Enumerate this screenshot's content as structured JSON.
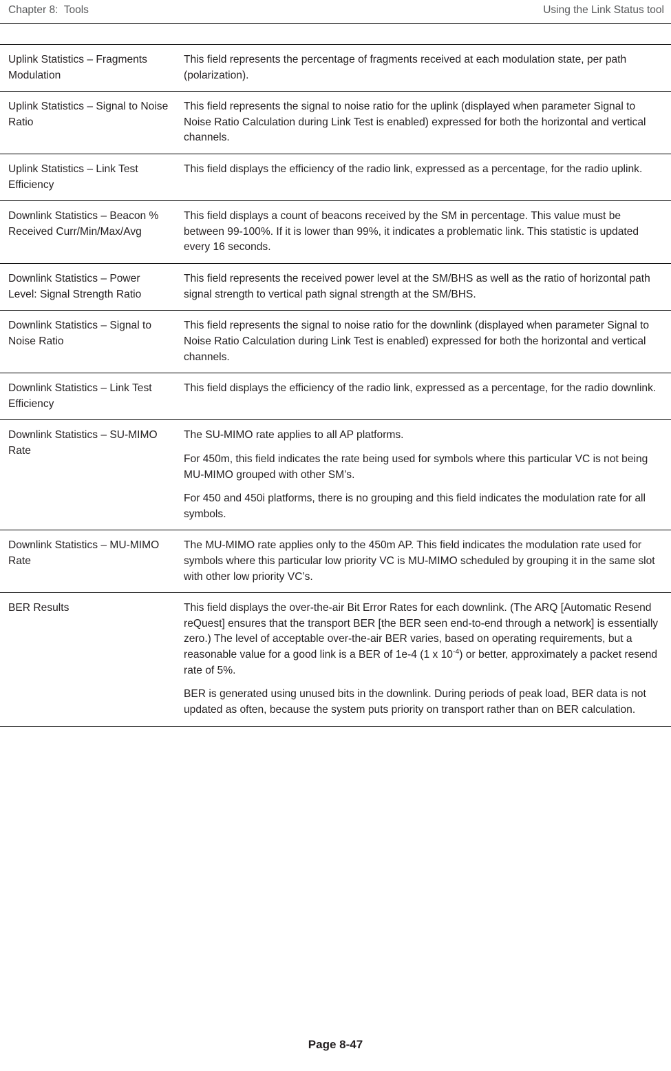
{
  "header": {
    "left": "Chapter 8:  Tools",
    "right": "Using the Link Status tool"
  },
  "rows": [
    {
      "term": "Uplink Statistics – Fragments Modulation",
      "paragraphs": [
        "This field represents the percentage of fragments received at each modulation state, per path (polarization)."
      ]
    },
    {
      "term": "Uplink Statistics – Signal to Noise Ratio",
      "paragraphs": [
        "This field represents the signal to noise ratio for the uplink (displayed when parameter Signal to Noise Ratio Calculation during Link Test is enabled) expressed for both the horizontal and vertical channels."
      ]
    },
    {
      "term": "Uplink Statistics – Link Test Efficiency",
      "paragraphs": [
        "This field displays the efficiency of the radio link, expressed as a percentage, for the radio uplink."
      ]
    },
    {
      "term": "Downlink Statistics – Beacon % Received Curr/Min/Max/Avg",
      "paragraphs": [
        "This field displays a count of beacons received by the SM in percentage. This value must be between 99-100%. If it is lower than 99%, it indicates a problematic link. This statistic is updated every 16 seconds."
      ]
    },
    {
      "term": "Downlink Statistics – Power Level: Signal Strength Ratio",
      "paragraphs": [
        "This field represents the received power level at the SM/BHS as well as the ratio of horizontal path signal strength to vertical path signal strength at the SM/BHS."
      ]
    },
    {
      "term": "Downlink Statistics – Signal to Noise Ratio",
      "paragraphs": [
        "This field represents the signal to noise ratio for the downlink (displayed when parameter Signal to Noise Ratio Calculation during Link Test is enabled) expressed for both the horizontal and vertical channels."
      ]
    },
    {
      "term": "Downlink Statistics – Link Test Efficiency",
      "paragraphs": [
        "This field displays the efficiency of the radio link, expressed as a percentage, for the radio downlink."
      ]
    },
    {
      "term": "Downlink Statistics – SU-MIMO Rate",
      "paragraphs": [
        "The SU-MIMO rate applies to all AP platforms.",
        "For 450m, this field indicates the rate being used for symbols where this particular VC is not being MU-MIMO grouped with other SM’s.",
        "For 450 and 450i platforms, there is no grouping and this field indicates the modulation rate for all symbols."
      ]
    },
    {
      "term": "Downlink Statistics – MU-MIMO Rate",
      "paragraphs": [
        "The MU-MIMO rate applies only to the 450m AP. This field indicates the modulation rate used for symbols where this particular low priority VC is MU-MIMO scheduled by grouping it in the same slot with other low priority VC’s."
      ]
    },
    {
      "term": "BER Results",
      "paragraphs": [
        "BER_SPECIAL",
        "BER is generated using unused bits in the downlink. During periods of peak load, BER data is not updated as often, because the system puts priority on transport rather than on BER calculation."
      ]
    }
  ],
  "ber_text": {
    "part1": "This field displays the over-the-air Bit Error Rates for each downlink. (The ARQ [Automatic Resend reQuest] ensures that the transport BER [the BER seen end-to-end through a network] is essentially zero.) The level of acceptable over-the-air BER varies, based on operating requirements, but a reasonable value for a good link is a BER of 1e-4 (1 x 10",
    "sup": "-4",
    "part2": ") or better, approximately a packet resend rate of 5%."
  },
  "footer": {
    "page_label": "Page 8-47"
  }
}
